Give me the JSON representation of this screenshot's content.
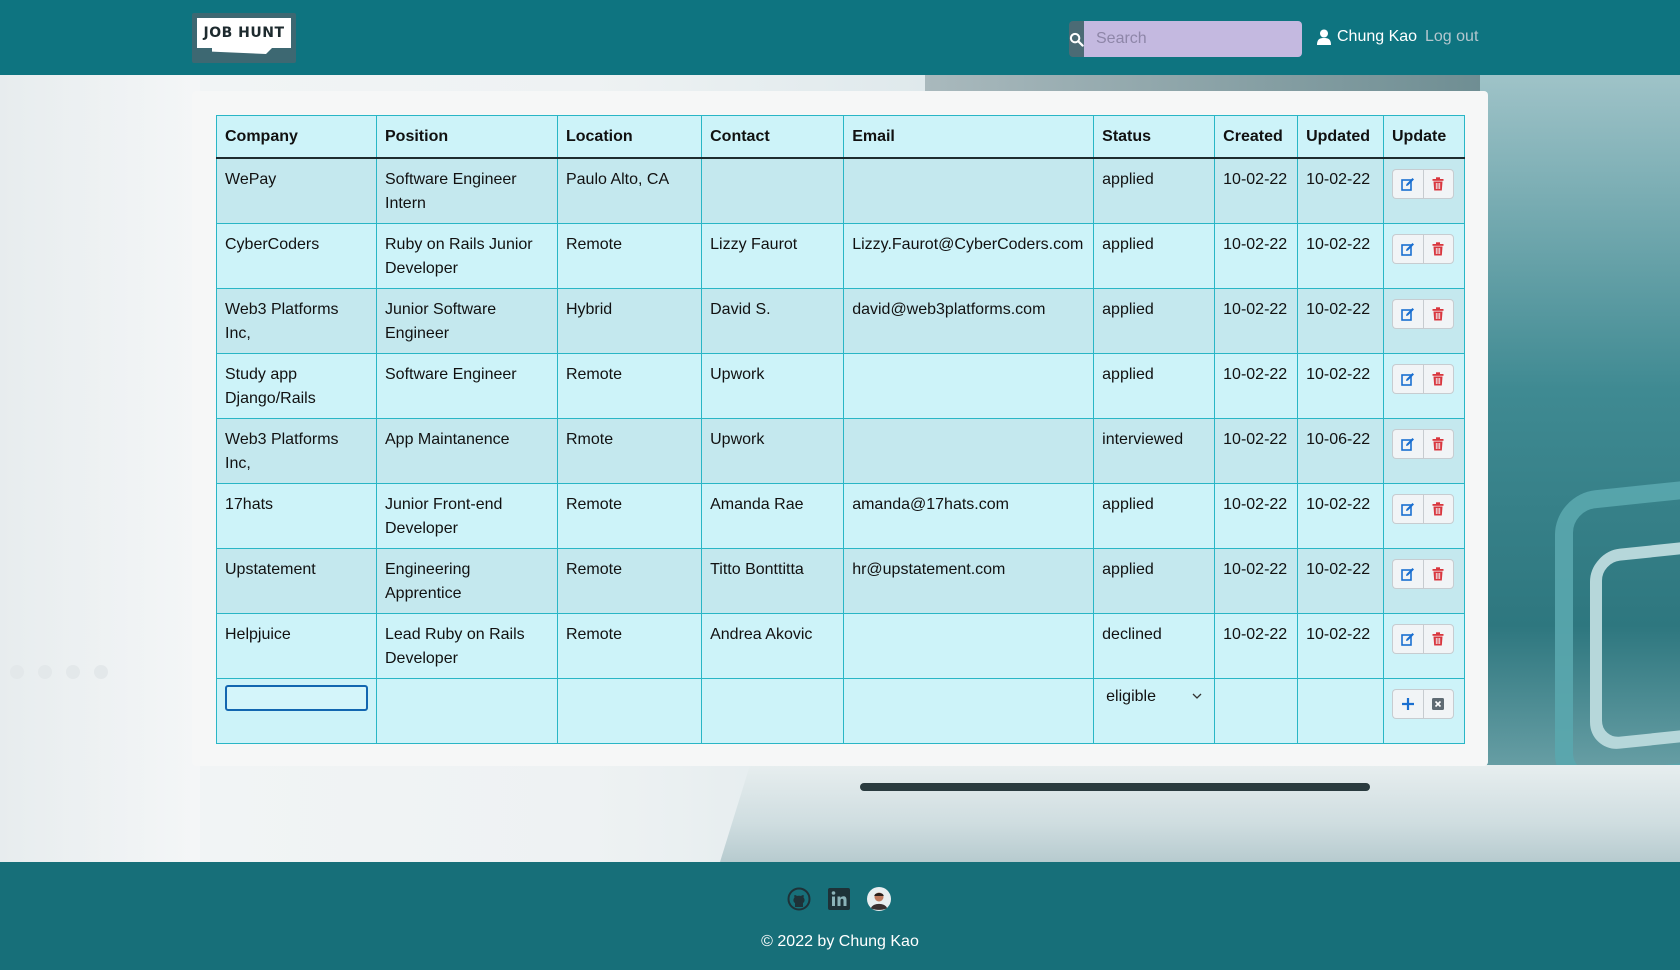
{
  "header": {
    "logo_text": "JOB HUNT",
    "search_placeholder": "Search",
    "user_name": "Chung Kao",
    "logout_label": "Log out"
  },
  "table": {
    "columns": [
      "Company",
      "Position",
      "Location",
      "Contact",
      "Email",
      "Status",
      "Created",
      "Updated",
      "Update"
    ],
    "rows": [
      {
        "company": "WePay",
        "position": "Software Engineer Intern",
        "location": "Paulo Alto, CA",
        "contact": "",
        "email": "",
        "status": "applied",
        "created": "10-02-22",
        "updated": "10-02-22"
      },
      {
        "company": "CyberCoders",
        "position": "Ruby on Rails Junior Developer",
        "location": "Remote",
        "contact": "Lizzy Faurot",
        "email": "Lizzy.Faurot@CyberCoders.com",
        "status": "applied",
        "created": "10-02-22",
        "updated": "10-02-22"
      },
      {
        "company": "Web3 Platforms Inc,",
        "position": "Junior Software Engineer",
        "location": "Hybrid",
        "contact": "David S.",
        "email": "david@web3platforms.com",
        "status": "applied",
        "created": "10-02-22",
        "updated": "10-02-22"
      },
      {
        "company": "Study app Django/Rails",
        "position": "Software Engineer",
        "location": "Remote",
        "contact": "Upwork",
        "email": "",
        "status": "applied",
        "created": "10-02-22",
        "updated": "10-02-22"
      },
      {
        "company": "Web3 Platforms Inc,",
        "position": "App Maintanence",
        "location": "Rmote",
        "contact": "Upwork",
        "email": "",
        "status": "interviewed",
        "created": "10-02-22",
        "updated": "10-06-22"
      },
      {
        "company": "17hats",
        "position": "Junior Front-end Developer",
        "location": "Remote",
        "contact": "Amanda Rae",
        "email": "amanda@17hats.com",
        "status": "applied",
        "created": "10-02-22",
        "updated": "10-02-22"
      },
      {
        "company": "Upstatement",
        "position": "Engineering Apprentice",
        "location": "Remote",
        "contact": "Titto Bonttitta",
        "email": "hr@upstatement.com",
        "status": "applied",
        "created": "10-02-22",
        "updated": "10-02-22"
      },
      {
        "company": "Helpjuice",
        "position": "Lead Ruby on Rails Developer",
        "location": "Remote",
        "contact": "Andrea Akovic",
        "email": "",
        "status": "declined",
        "created": "10-02-22",
        "updated": "10-02-22"
      }
    ],
    "new_row": {
      "status_selected": "eligible"
    }
  },
  "footer": {
    "icons": [
      "github-icon",
      "linkedin-icon",
      "profile-avatar-icon"
    ],
    "copyright": "© 2022 by Chung Kao"
  },
  "colors": {
    "header_bg": "#0e7480",
    "footer_bg": "#176f79",
    "table_border": "#29b6c6",
    "edit_icon": "#1a6fd0",
    "delete_icon": "#d9363e"
  }
}
